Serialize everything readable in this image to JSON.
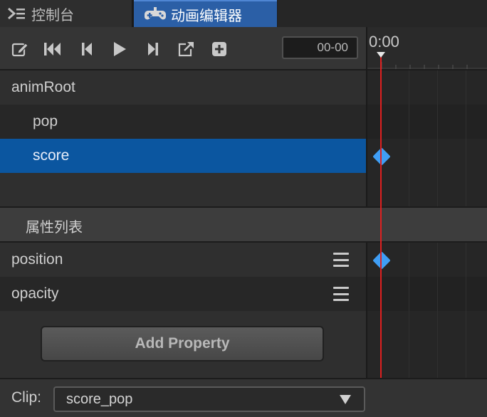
{
  "tabs": [
    {
      "label": "控制台",
      "icon": "terminal-icon",
      "active": false
    },
    {
      "label": "动画编辑器",
      "icon": "gamepad-icon",
      "active": true
    }
  ],
  "toolbar": {
    "buttons": [
      "edit-icon",
      "jump-first-icon",
      "prev-frame-icon",
      "play-icon",
      "next-frame-icon",
      "export-icon",
      "add-icon"
    ],
    "time_value": "00-00"
  },
  "timeline": {
    "current_time": "0:00",
    "playhead_color": "#e02020",
    "keyframe_color": "#3f9ef5"
  },
  "tree": {
    "nodes": [
      {
        "label": "animRoot",
        "depth": 0,
        "selected": false
      },
      {
        "label": "pop",
        "depth": 1,
        "selected": false
      },
      {
        "label": "score",
        "depth": 1,
        "selected": true
      }
    ],
    "selected_color": "#0b56a0"
  },
  "properties": {
    "title": "属性列表",
    "items": [
      {
        "label": "position",
        "has_keyframe": true
      },
      {
        "label": "opacity",
        "has_keyframe": false
      }
    ],
    "add_button": "Add Property"
  },
  "footer": {
    "clip_label": "Clip:",
    "clip_value": "score_pop"
  }
}
